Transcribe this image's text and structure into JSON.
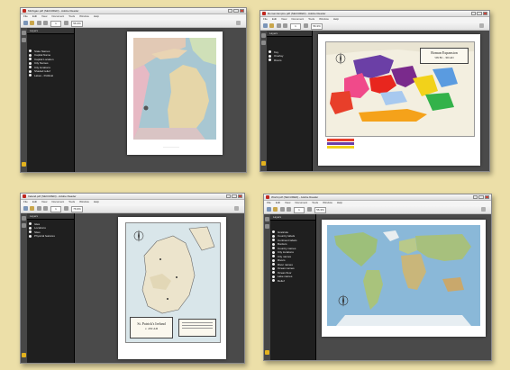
{
  "menus": [
    "File",
    "Edit",
    "View",
    "Document",
    "Tools",
    "Window",
    "Help"
  ],
  "windows": {
    "michigan": {
      "title": "Michigan.pdf (SECURED) - Adobe Reader",
      "page": "1",
      "zoom": "56.3%",
      "layers_title": "Layers",
      "layers": [
        "State Names",
        "Capital Name",
        "Capital Location",
        "City Names",
        "City locations",
        "Shaded relief",
        "Lakes - Political"
      ]
    },
    "roman": {
      "title": "Roman Empire.pdf (SECURED) - Adobe Reader",
      "page": "1",
      "zoom": "56.3%",
      "layers_title": "Layers",
      "layers": [
        "Key",
        "Overlay",
        "Rivers"
      ],
      "map_title_line1": "Roman Expansion",
      "map_title_line2": "509 BC - 300 AD"
    },
    "ireland": {
      "title": "Ireland.pdf (SECURED) - Adobe Reader",
      "page": "1",
      "zoom": "76.9%",
      "layers_title": "Layers",
      "layers": [
        "Isles",
        "Locations",
        "Sites",
        "Physical features"
      ],
      "map_title_line1": "St. Patrick's Ireland",
      "map_title_line2": "c. 450 AD"
    },
    "world": {
      "title": "World.pdf (SECURED) - Adobe Reader",
      "page": "1",
      "zoom": "56.3%",
      "layers_title": "Layers",
      "layers": [
        "Graticule",
        "Country labels",
        "Continent labels",
        "Borders",
        "Country names",
        "City locations",
        "City names",
        "Rivers",
        "River names",
        "Ocean names",
        "Ocean floor",
        "Lake names",
        "Relief"
      ]
    }
  },
  "colors": {
    "background": "#ecdfa8",
    "viewer_dark": "#4a4a4a",
    "layers_panel": "#1f1f1f",
    "accent_folder": "#e3b21e",
    "acrobat_red": "#c0271e"
  }
}
